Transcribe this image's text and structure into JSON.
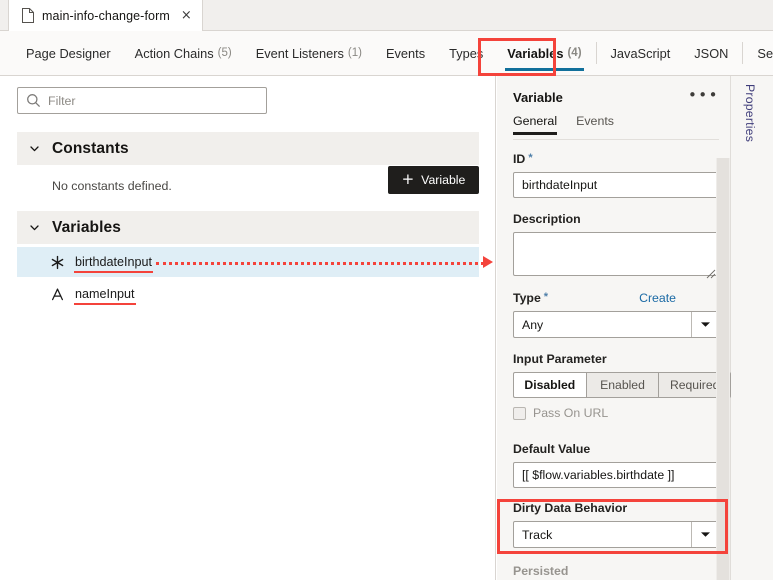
{
  "window": {
    "document_tab": {
      "icon": "document-icon",
      "label": "main-info-change-form",
      "close": "×"
    }
  },
  "nav": {
    "tabs": [
      {
        "label": "Page Designer",
        "count": "",
        "active": false
      },
      {
        "label": "Action Chains",
        "count": "(5)",
        "active": false
      },
      {
        "label": "Event Listeners",
        "count": "(1)",
        "active": false
      },
      {
        "label": "Events",
        "count": "",
        "active": false
      },
      {
        "label": "Types",
        "count": "",
        "active": false
      },
      {
        "label": "Variables",
        "count": "(4)",
        "active": true
      },
      {
        "label": "JavaScript",
        "count": "",
        "active": false
      },
      {
        "label": "JSON",
        "count": "",
        "active": false
      },
      {
        "label": "Settings",
        "count": "",
        "active": false
      }
    ]
  },
  "left": {
    "filter": {
      "placeholder": "Filter",
      "value": "",
      "icon": "search-icon"
    },
    "add_variable_button": {
      "plus": "+",
      "label": "Variable"
    },
    "constants_section": {
      "title": "Constants",
      "empty_text": "No constants defined.",
      "expanded": true
    },
    "variables_section": {
      "title": "Variables",
      "expanded": true,
      "items": [
        {
          "name": "birthdateInput",
          "type_icon": "any-type-icon",
          "selected": true
        },
        {
          "name": "nameInput",
          "type_icon": "string-type-icon",
          "selected": false
        }
      ]
    }
  },
  "right": {
    "panel_title": "Variable",
    "kebab": "•••",
    "tabs": [
      {
        "label": "General",
        "active": true
      },
      {
        "label": "Events",
        "active": false
      }
    ],
    "fields": {
      "id": {
        "label": "ID",
        "required_mark": "*",
        "value": "birthdateInput"
      },
      "description": {
        "label": "Description",
        "value": ""
      },
      "type": {
        "label": "Type",
        "required_mark": "*",
        "create_link": "Create",
        "value": "Any"
      },
      "input_parameter": {
        "label": "Input Parameter",
        "options": [
          "Disabled",
          "Enabled",
          "Required"
        ],
        "selected": "Disabled"
      },
      "pass_on_url": {
        "label": "Pass On URL",
        "checked": false,
        "disabled": true
      },
      "default_value": {
        "label": "Default Value",
        "value": "[[ $flow.variables.birthdate ]]"
      },
      "dirty_data_behavior": {
        "label": "Dirty Data Behavior",
        "value": "Track"
      },
      "persisted": {
        "label": "Persisted"
      }
    },
    "rail_label": "Properties"
  },
  "annotations": {
    "highlight_color": "#f4433b",
    "boxes": [
      "variables-tab",
      "dirty-data-behavior"
    ],
    "arrow": "birthdateInput-to-properties"
  },
  "colors": {
    "accent_tab_underline": "#12709b",
    "button_dark": "#1f1e1c",
    "selection_blue": "#dfeef6",
    "link_blue": "#1b6aa5",
    "annotation_red": "#f4433b"
  }
}
